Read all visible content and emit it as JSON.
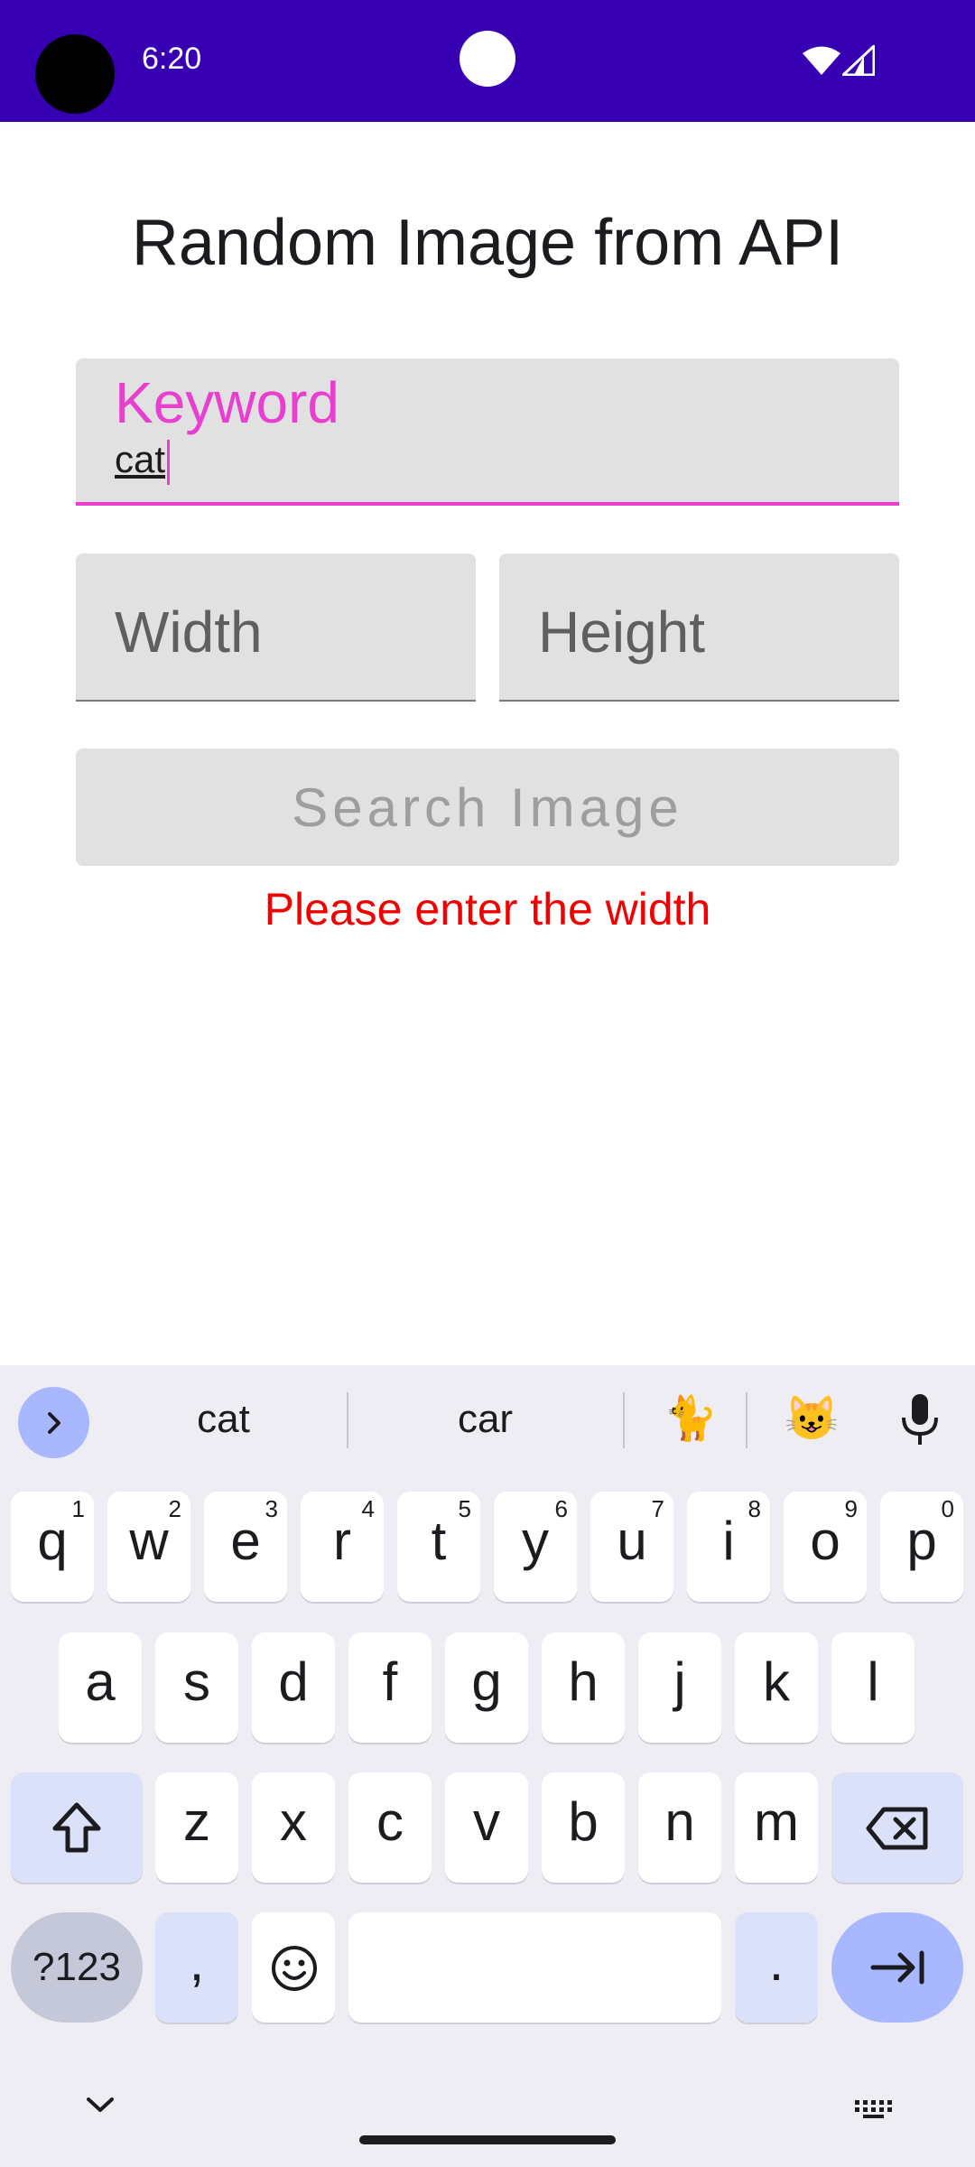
{
  "status_bar": {
    "time": "6:20",
    "icons": [
      "camera-cutout",
      "notification-dot-icon",
      "wifi-icon",
      "signal-icon"
    ],
    "background_color": "#3700b3"
  },
  "app": {
    "title": "Random Image from API",
    "keyword_field": {
      "label": "Keyword",
      "value": "cat",
      "accent_color": "#e83fd0"
    },
    "width_field": {
      "placeholder": "Width",
      "value": ""
    },
    "height_field": {
      "placeholder": "Height",
      "value": ""
    },
    "search_button": {
      "label": "Search Image",
      "enabled": false
    },
    "error_message": {
      "text": "Please enter the width",
      "color": "#f20000"
    }
  },
  "keyboard": {
    "suggestions": [
      "cat",
      "car"
    ],
    "emoji_suggestions": [
      "🐈",
      "😺"
    ],
    "row1": [
      {
        "key": "q",
        "num": "1"
      },
      {
        "key": "w",
        "num": "2"
      },
      {
        "key": "e",
        "num": "3"
      },
      {
        "key": "r",
        "num": "4"
      },
      {
        "key": "t",
        "num": "5"
      },
      {
        "key": "y",
        "num": "6"
      },
      {
        "key": "u",
        "num": "7"
      },
      {
        "key": "i",
        "num": "8"
      },
      {
        "key": "o",
        "num": "9"
      },
      {
        "key": "p",
        "num": "0"
      }
    ],
    "row2": [
      "a",
      "s",
      "d",
      "f",
      "g",
      "h",
      "j",
      "k",
      "l"
    ],
    "row3": [
      "z",
      "x",
      "c",
      "v",
      "b",
      "n",
      "m"
    ],
    "symbols_key": "?123",
    "comma_key": ",",
    "period_key": "."
  }
}
